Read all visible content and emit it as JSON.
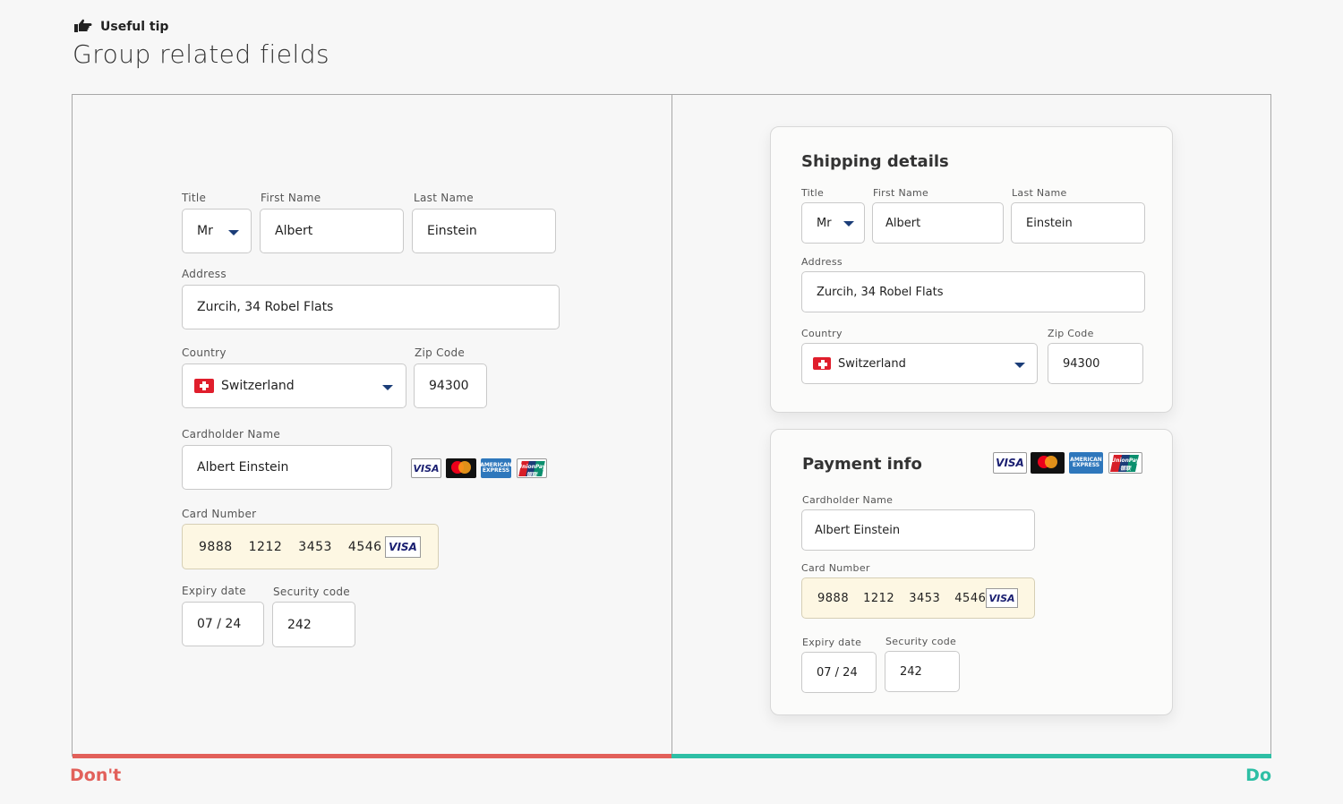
{
  "header": {
    "tip_label": "Useful tip",
    "headline": "Group related fields"
  },
  "labels": {
    "dont": "Don't",
    "do": "Do"
  },
  "colors": {
    "dont": "#e2605a",
    "do": "#2ebfa5",
    "card_bg": "#fdf7e3",
    "caret": "#1b3d78"
  },
  "form": {
    "title_label": "Title",
    "title_value": "Mr",
    "first_name_label": "First Name",
    "first_name_value": "Albert",
    "last_name_label": "Last Name",
    "last_name_value": "Einstein",
    "address_label": "Address",
    "address_value": "Zurcih, 34 Robel Flats",
    "country_label": "Country",
    "country_value": "Switzerland",
    "zip_label": "Zip Code",
    "zip_value": "94300",
    "cardholder_label": "Cardholder Name",
    "cardholder_value": "Albert Einstein",
    "card_number_label": "Card Number",
    "card_number_groups": [
      "9888",
      "1212",
      "3453",
      "4546"
    ],
    "card_brand": "VISA",
    "expiry_label": "Expiry date",
    "expiry_value": "07 / 24",
    "cvc_label": "Security code",
    "cvc_value": "242"
  },
  "logos": {
    "visa": "VISA",
    "amex": "AMERICAN EXPRESS",
    "unionpay": "UnionPay 银联"
  },
  "panels": {
    "shipping_title": "Shipping details",
    "payment_title": "Payment info"
  }
}
